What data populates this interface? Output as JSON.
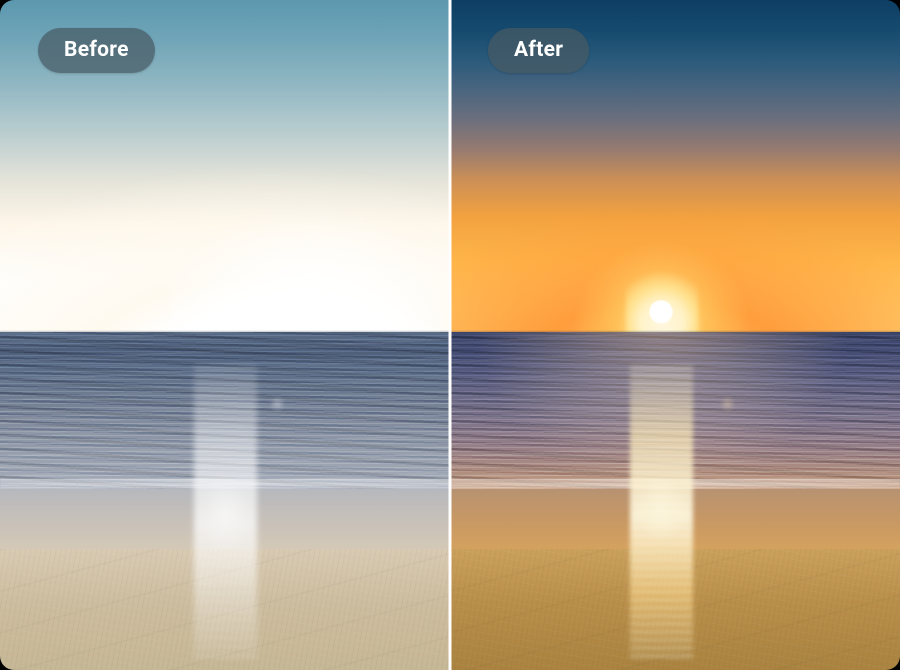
{
  "labels": {
    "before": "Before",
    "after": "After"
  },
  "colors": {
    "badge_bg": "rgba(70,90,100,.72)",
    "badge_text": "#ffffff",
    "divider": "#ffffff"
  },
  "scene": {
    "description": "Beach sunset comparison: overexposed original vs color-corrected result",
    "subject": "ocean-sunset-beach",
    "before": {
      "exposure": "overexposed",
      "saturation": "low",
      "sky_tone": "pale-cyan-white"
    },
    "after": {
      "exposure": "balanced",
      "saturation": "high",
      "sky_tone": "deep-blue-to-orange"
    }
  }
}
